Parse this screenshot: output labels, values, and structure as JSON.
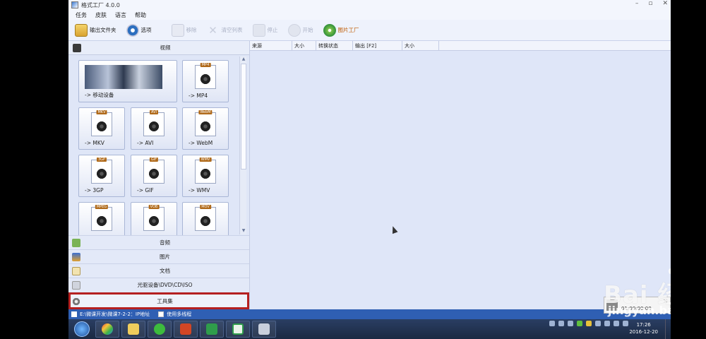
{
  "window": {
    "title": "格式工厂 4.0.0",
    "controls": [
      "–",
      "▫",
      "✕"
    ]
  },
  "menu": {
    "items": [
      "任务",
      "皮肤",
      "语言",
      "帮助"
    ]
  },
  "toolbar": {
    "output_folder": "输出文件夹",
    "options": "选项",
    "remove": "移除",
    "clear_list": "清空列表",
    "stop": "停止",
    "start": "开始",
    "brand": "图片工厂"
  },
  "sidebar": {
    "video_header": "视频",
    "tiles": [
      {
        "label": "-> 移动设备",
        "badge": ""
      },
      {
        "label": "-> MP4",
        "badge": "MP4"
      },
      {
        "label": "-> MKV",
        "badge": "MKV"
      },
      {
        "label": "-> AVI",
        "badge": "AVI"
      },
      {
        "label": "-> WebM",
        "badge": "WebM"
      },
      {
        "label": "-> 3GP",
        "badge": "3GP"
      },
      {
        "label": "-> GIF",
        "badge": "GIF"
      },
      {
        "label": "-> WMV",
        "badge": "WMV"
      },
      {
        "label": "",
        "badge": "MPEG"
      },
      {
        "label": "",
        "badge": "VOB"
      },
      {
        "label": "",
        "badge": "MOV"
      }
    ],
    "categories": [
      {
        "label": "音频"
      },
      {
        "label": "图片"
      },
      {
        "label": "文档"
      },
      {
        "label": "光驱设备\\DVD\\CD\\ISO"
      },
      {
        "label": "工具集"
      }
    ]
  },
  "file_list": {
    "columns": [
      "来源",
      "大小",
      "转换状态",
      "输出 [F2]",
      "大小"
    ]
  },
  "statusbar": {
    "path": "E:\\微课开发\\微课7-2-2：IP地址",
    "multithread": "使用多线程"
  },
  "taskbar": {
    "time": "17:26",
    "date": "2016-12-20"
  },
  "popup": {
    "time": "01:00:00:00"
  },
  "watermark": {
    "logo": "Bai 经验",
    "url": "jingyan.baidu.com"
  },
  "colors": {
    "highlight_box": "#b52020",
    "statusbar": "#2f5fb3",
    "panel": "#dfe6f7"
  }
}
